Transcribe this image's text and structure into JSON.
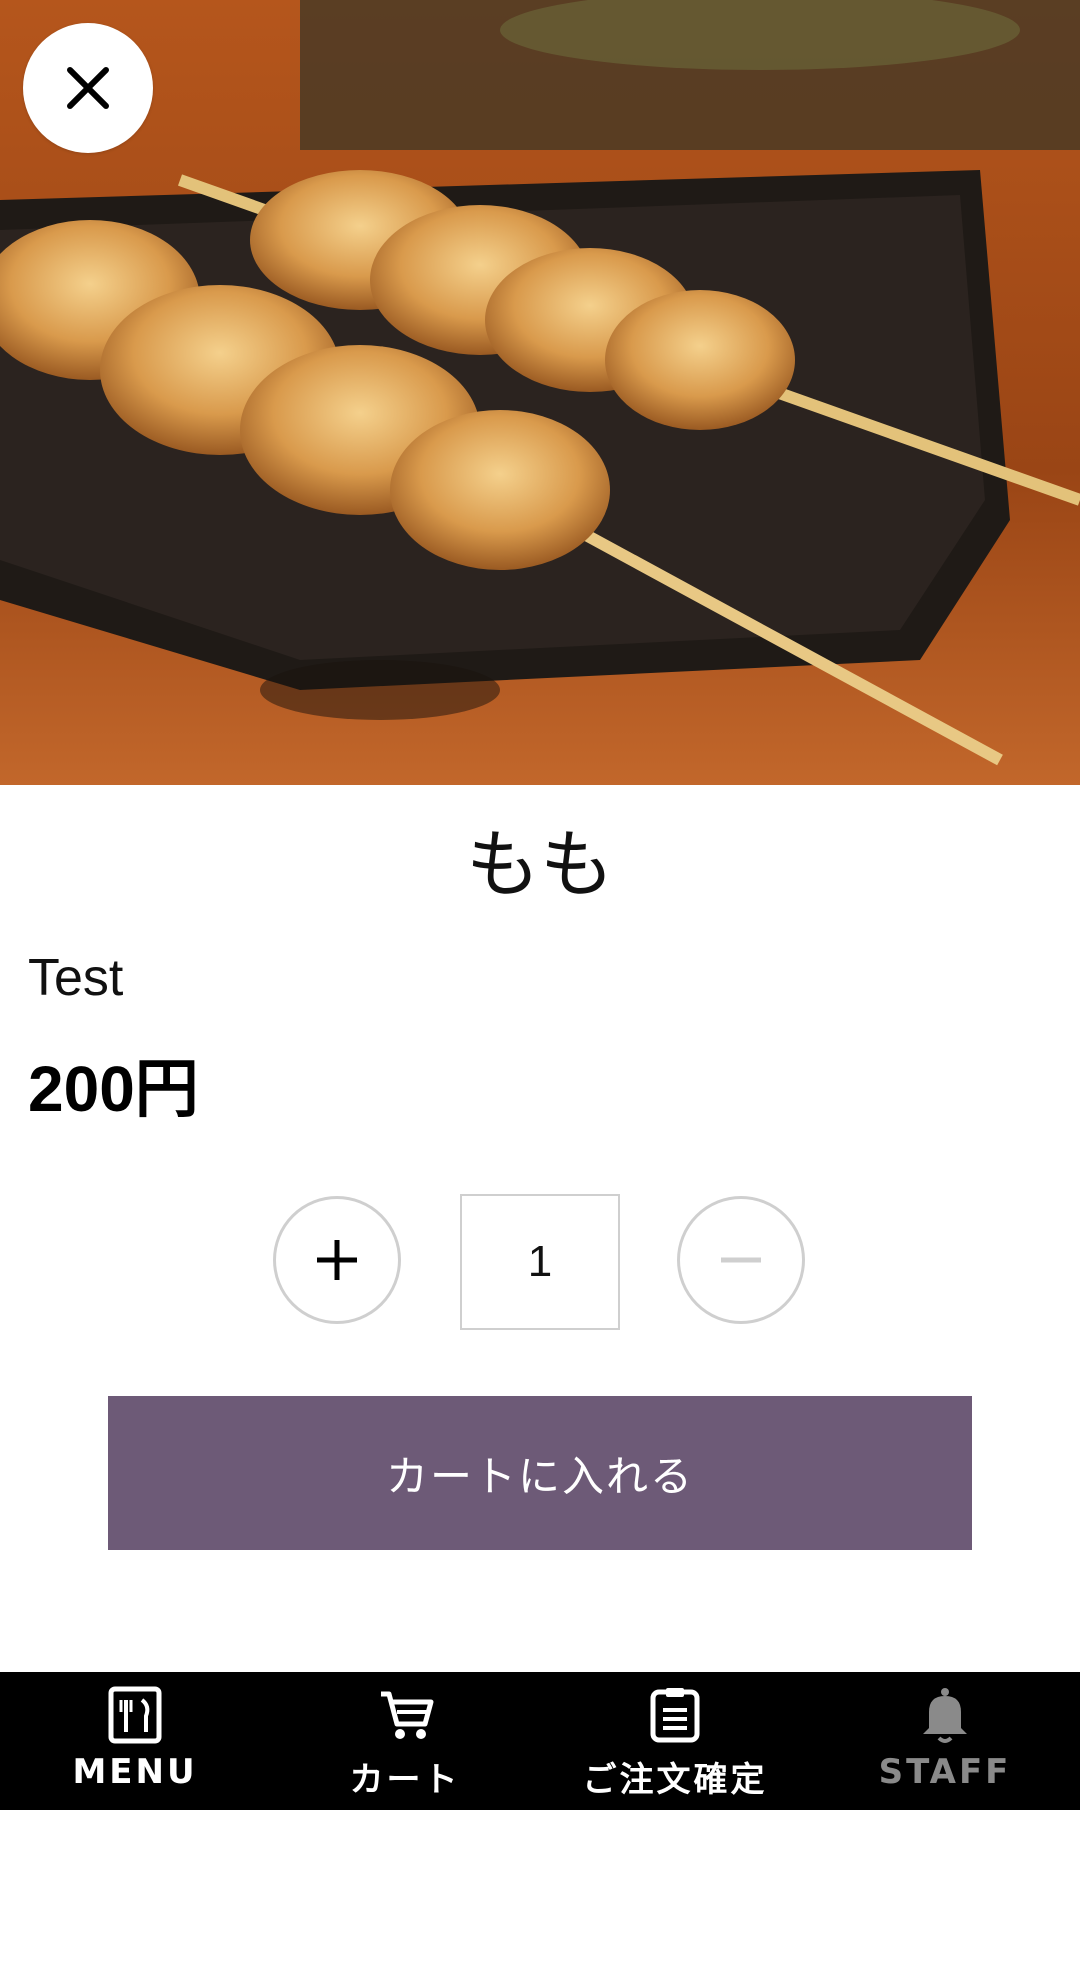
{
  "product": {
    "name": "もも",
    "description": "Test",
    "price": "200円",
    "image_icon": "yakitori-skewer-photo"
  },
  "quantity": {
    "value": "1",
    "increment_icon": "plus-icon",
    "decrement_icon": "minus-icon"
  },
  "actions": {
    "add_to_cart_label": "カートに入れる",
    "close_icon": "close-icon"
  },
  "nav": {
    "items": [
      {
        "label": "MENU",
        "icon": "menu-icon"
      },
      {
        "label": "カート",
        "icon": "cart-icon"
      },
      {
        "label": "ご注文確定",
        "icon": "order-confirm-icon"
      },
      {
        "label": "STAFF",
        "icon": "bell-icon"
      }
    ]
  },
  "colors": {
    "accent": "#6d5a77",
    "nav_bg": "#000000",
    "border": "#cfcfcf"
  }
}
